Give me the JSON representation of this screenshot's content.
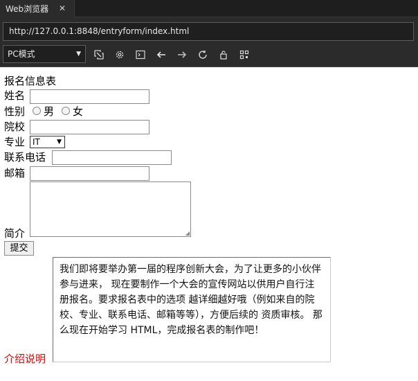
{
  "browser": {
    "tab_title": "Web浏览器",
    "tab_close": "✕",
    "url": "http://127.0.0.1:8848/entryform/index.html",
    "mode": "PC模式",
    "toolbar_icons": [
      "screenshot-icon",
      "gear-icon",
      "terminal-icon",
      "back-arrow-icon",
      "forward-arrow-icon",
      "refresh-icon",
      "lock-icon",
      "qrcode-icon"
    ]
  },
  "form": {
    "title": "报名信息表",
    "name_label": "姓名",
    "gender_label": "性别",
    "gender_male": "男",
    "gender_female": "女",
    "school_label": "院校",
    "major_label": "专业",
    "major_value": "IT",
    "phone_label": "联系电话",
    "email_label": "邮箱",
    "intro_label": "简介",
    "submit": "提交"
  },
  "intro": {
    "label": "介绍说明",
    "text": "我们即将要举办第一届的程序创新大会，为了让更多的小伙伴参与进来， 现在要制作一个大会的宣传网站以供用户自行注册报名。要求报名表中的选项 越详细越好哦（例如来自的院校、专业、联系电话、邮箱等等），方便后续的 资质审核。 那么现在开始学习 HTML，完成报名表的制作吧！"
  }
}
